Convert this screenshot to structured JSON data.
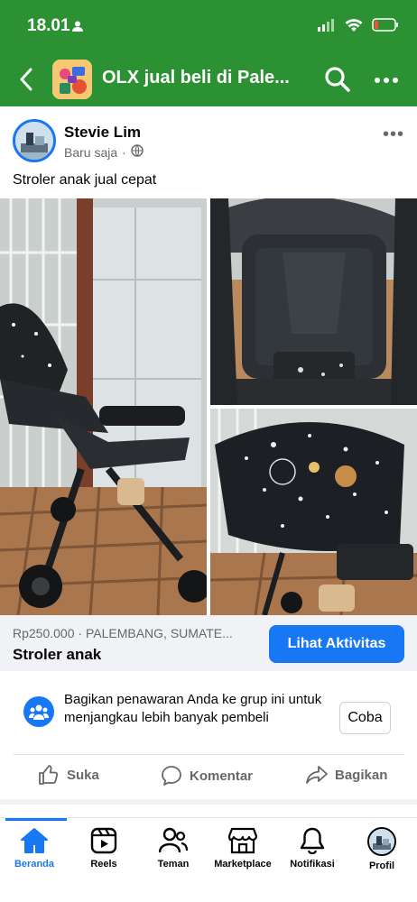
{
  "status_bar": {
    "time": "18.01"
  },
  "app_bar": {
    "title": "OLX jual beli di Pale..."
  },
  "post": {
    "author": "Stevie Lim",
    "time_ago": "Baru saja",
    "separator": "·",
    "text": "Stroler anak jual cepat",
    "more_label": "•••"
  },
  "listing": {
    "price_location": "Rp250.000 · PALEMBANG, SUMATE...",
    "title": "Stroler anak",
    "cta_label": "Lihat Aktivitas"
  },
  "share_prompt": {
    "text": "Bagikan penawaran Anda ke grup ini untuk menjangkau lebih banyak pembeli",
    "button_label": "Coba"
  },
  "actions": {
    "like": "Suka",
    "comment": "Komentar",
    "share": "Bagikan"
  },
  "bottom_nav": {
    "items": [
      {
        "label": "Beranda",
        "icon": "home-icon",
        "active": true
      },
      {
        "label": "Reels",
        "icon": "reels-icon",
        "active": false
      },
      {
        "label": "Teman",
        "icon": "friends-icon",
        "active": false
      },
      {
        "label": "Marketplace",
        "icon": "marketplace-icon",
        "active": false
      },
      {
        "label": "Notifikasi",
        "icon": "bell-icon",
        "active": false
      },
      {
        "label": "Profil",
        "icon": "profile-avatar",
        "active": false
      }
    ]
  },
  "colors": {
    "app_bar": "#2b9133",
    "accent": "#1877f2",
    "secondary_text": "#65676b"
  }
}
